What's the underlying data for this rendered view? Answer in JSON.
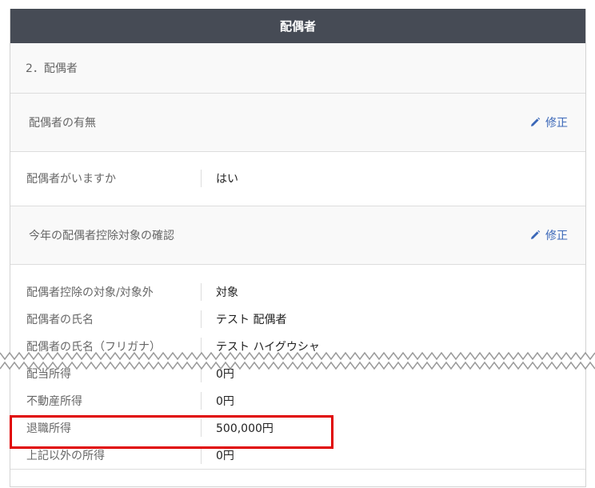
{
  "header": {
    "title": "配偶者"
  },
  "section": {
    "title": "2．配偶者"
  },
  "presence": {
    "title": "配偶者の有無",
    "edit_label": "修正",
    "rows": [
      {
        "label": "配偶者がいますか",
        "value": "はい"
      }
    ]
  },
  "deduction": {
    "title": "今年の配偶者控除対象の確認",
    "edit_label": "修正",
    "rows": [
      {
        "label": "配偶者控除の対象/対象外",
        "value": "対象"
      },
      {
        "label": "配偶者の氏名",
        "value": "テスト 配偶者"
      },
      {
        "label": "配偶者の氏名（フリガナ）",
        "value": "テスト ハイグウシャ"
      },
      {
        "label": "配当所得",
        "value": "0円"
      },
      {
        "label": "不動産所得",
        "value": "0円"
      },
      {
        "label": "退職所得",
        "value": "500,000円"
      },
      {
        "label": "上記以外の所得",
        "value": "0円"
      }
    ]
  },
  "colors": {
    "header_bg": "#464b55",
    "link": "#3a67b8",
    "highlight": "#e00000"
  }
}
